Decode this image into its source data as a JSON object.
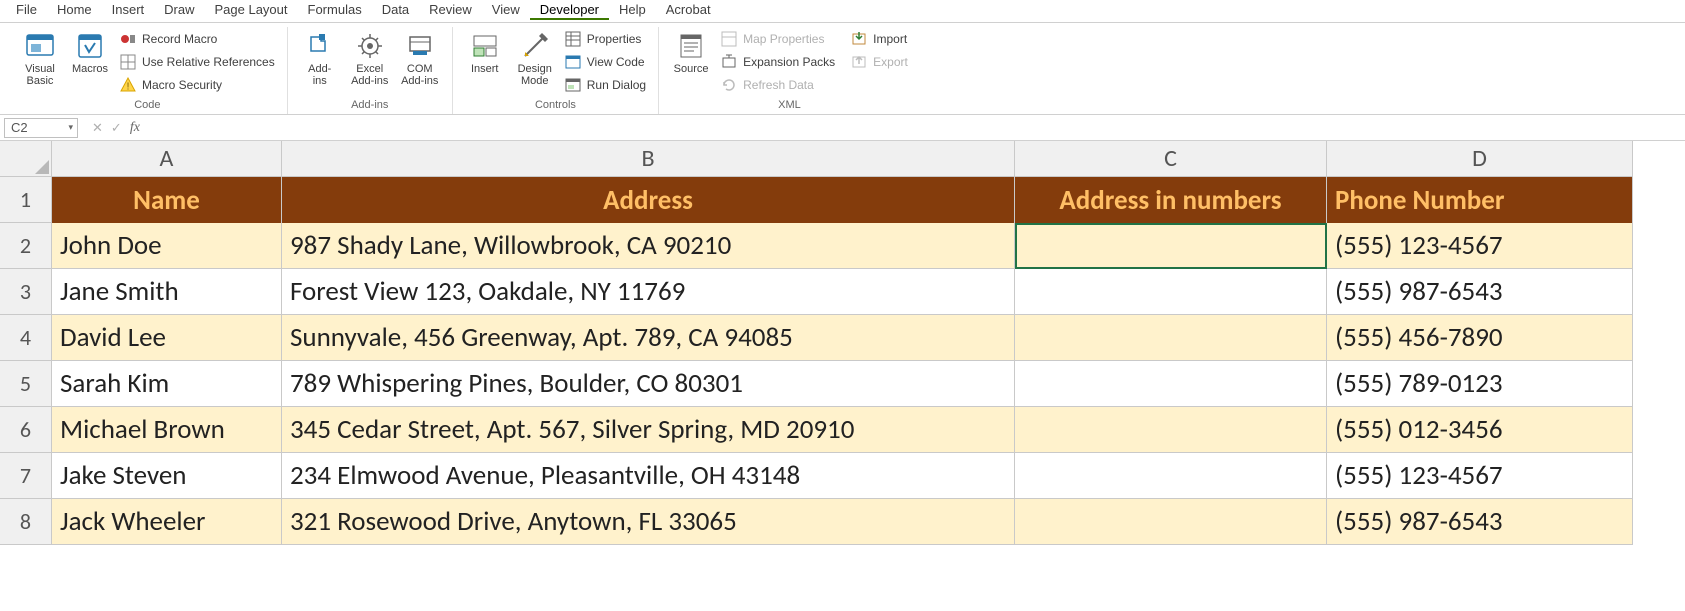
{
  "menu": {
    "items": [
      "File",
      "Home",
      "Insert",
      "Draw",
      "Page Layout",
      "Formulas",
      "Data",
      "Review",
      "View",
      "Developer",
      "Help",
      "Acrobat"
    ],
    "active": "Developer"
  },
  "ribbon": {
    "groups": {
      "code": {
        "caption": "Code",
        "visual_basic": "Visual\nBasic",
        "macros": "Macros",
        "record_macro": "Record Macro",
        "use_rel_refs": "Use Relative References",
        "macro_security": "Macro Security"
      },
      "addins": {
        "caption": "Add-ins",
        "addins": "Add-\nins",
        "excel_addins": "Excel\nAdd-ins",
        "com_addins": "COM\nAdd-ins"
      },
      "controls": {
        "caption": "Controls",
        "insert": "Insert",
        "design_mode": "Design\nMode",
        "properties": "Properties",
        "view_code": "View Code",
        "run_dialog": "Run Dialog"
      },
      "xml": {
        "caption": "XML",
        "source": "Source",
        "map_properties": "Map Properties",
        "expansion_packs": "Expansion Packs",
        "refresh_data": "Refresh Data",
        "import": "Import",
        "export": "Export"
      }
    }
  },
  "fxbar": {
    "namebox": "C2",
    "fx_label": "fx",
    "formula": ""
  },
  "sheet": {
    "col_labels": [
      "A",
      "B",
      "C",
      "D"
    ],
    "row_labels": [
      "1",
      "2",
      "3",
      "4",
      "5",
      "6",
      "7",
      "8"
    ],
    "headers": {
      "name": "Name",
      "address": "Address",
      "addr_num": "Address in numbers",
      "phone": "Phone Number"
    },
    "rows": [
      {
        "name": "John Doe",
        "address": "987 Shady Lane, Willowbrook, CA 90210",
        "addr_num": "",
        "phone": "(555) 123-4567"
      },
      {
        "name": "Jane Smith",
        "address": "Forest View 123, Oakdale, NY 11769",
        "addr_num": "",
        "phone": "(555) 987-6543"
      },
      {
        "name": "David Lee",
        "address": "Sunnyvale, 456 Greenway, Apt. 789, CA 94085",
        "addr_num": "",
        "phone": "(555) 456-7890"
      },
      {
        "name": "Sarah Kim",
        "address": "789 Whispering Pines, Boulder, CO 80301",
        "addr_num": "",
        "phone": "(555) 789-0123"
      },
      {
        "name": "Michael Brown",
        "address": "345 Cedar Street, Apt. 567, Silver Spring, MD 20910",
        "addr_num": "",
        "phone": "(555) 012-3456"
      },
      {
        "name": "Jake Steven",
        "address": "234 Elmwood Avenue, Pleasantville, OH 43148",
        "addr_num": "",
        "phone": "(555) 123-4567"
      },
      {
        "name": "Jack Wheeler",
        "address": "321 Rosewood Drive, Anytown, FL 33065",
        "addr_num": "",
        "phone": "(555) 987-6543"
      }
    ],
    "selected_cell": "C2",
    "colors": {
      "header_bg": "#843c0c",
      "header_fg": "#ffbf66",
      "band_bg": "#fff2cc"
    }
  }
}
